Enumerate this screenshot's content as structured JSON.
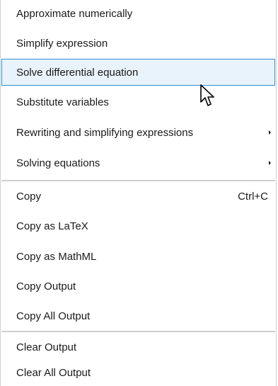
{
  "menu": {
    "groups": [
      [
        {
          "label": "Approximate numerically"
        },
        {
          "label": "Simplify expression"
        },
        {
          "label": "Solve differential equation",
          "highlighted": true
        },
        {
          "label": "Substitute variables"
        },
        {
          "label": "Rewriting and simplifying expressions",
          "submenu": true
        },
        {
          "label": "Solving equations",
          "submenu": true
        }
      ],
      [
        {
          "label": "Copy",
          "shortcut": "Ctrl+C"
        },
        {
          "label": "Copy as LaTeX"
        },
        {
          "label": "Copy as MathML"
        },
        {
          "label": "Copy Output"
        },
        {
          "label": "Copy All Output"
        }
      ],
      [
        {
          "label": "Clear Output"
        },
        {
          "label": "Clear All Output"
        }
      ]
    ]
  },
  "colors": {
    "highlight_background": "#e9f3fb",
    "highlight_border": "#2b8fd6",
    "separator": "#cfcfcf",
    "text": "#1a1a1a"
  },
  "icons": {
    "cursor": "mouse-pointer-icon",
    "submenu": "submenu-arrow-icon"
  }
}
